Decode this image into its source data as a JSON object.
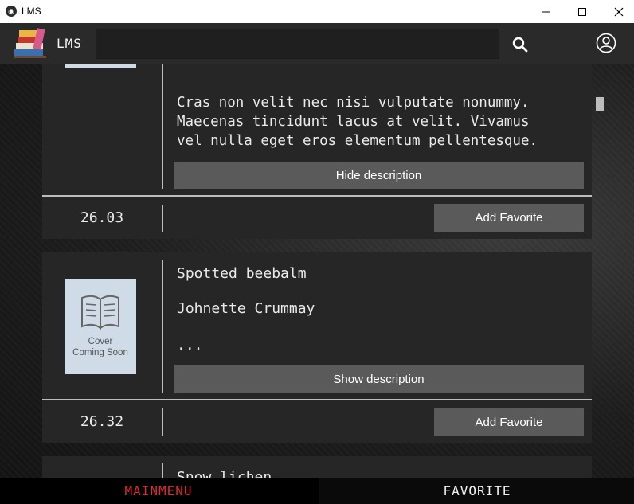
{
  "window": {
    "title": "LMS",
    "icon": "app-logo-icon"
  },
  "header": {
    "logo_text": "LMS",
    "search": {
      "value": "",
      "placeholder": ""
    },
    "search_icon": "search-icon",
    "account_icon": "account-icon"
  },
  "books": [
    {
      "description": "Cras non velit nec nisi vulputate nonummy. Maecenas tincidunt lacus at velit. Vivamus vel nulla eget eros elementum pellentesque.",
      "description_lines": [
        "Cras non velit nec nisi vulputate nonummy.",
        "Maecenas tincidunt lacus at velit. Vivamus",
        "vel nulla eget eros elementum pellentesque."
      ],
      "toggle_label": "Hide description",
      "price": "26.03",
      "favorite_label": "Add Favorite"
    },
    {
      "title": "Spotted beebalm",
      "author": "Johnette Crummay",
      "description": "...",
      "cover_caption_1": "Cover",
      "cover_caption_2": "Coming Soon",
      "toggle_label": "Show description",
      "price": "26.32",
      "favorite_label": "Add Favorite"
    },
    {
      "title": "Snow lichen"
    }
  ],
  "nav": {
    "main_label": "MAINMENU",
    "favorite_label": "FAVORITE"
  },
  "colors": {
    "active_tab": "#e0282e",
    "button": "#5a5a5a",
    "card": "#262626",
    "header": "#2a2a2a"
  }
}
